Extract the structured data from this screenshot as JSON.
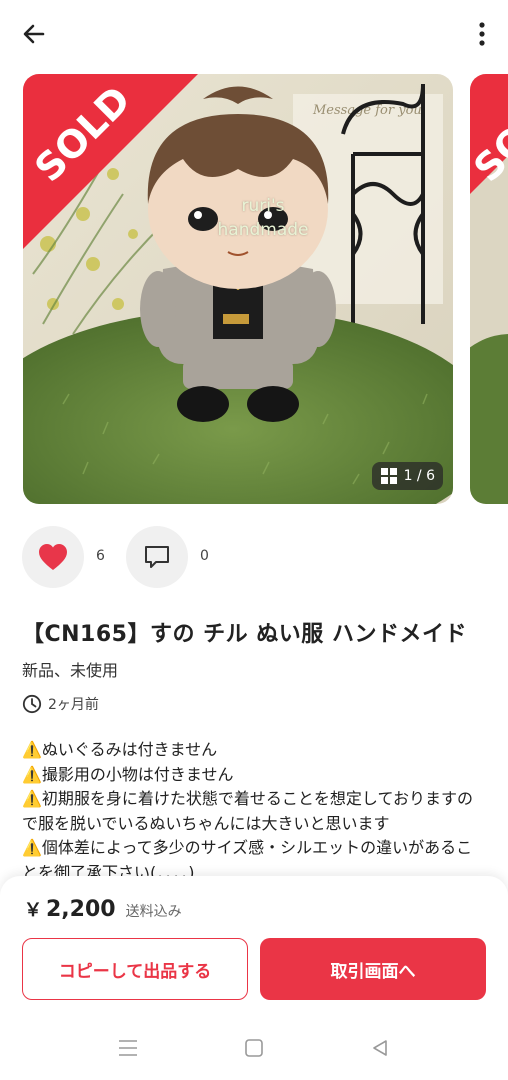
{
  "header": {
    "back_icon": "arrow-left-icon",
    "more_icon": "more-vertical-icon"
  },
  "gallery": {
    "sold_label": "SOLD",
    "watermark_line1": "ruri's",
    "watermark_line2": "handmade",
    "counter": "1 / 6",
    "counter_icon": "grid-icon"
  },
  "stats": {
    "likes": "6",
    "comments": "0"
  },
  "item": {
    "title": "【CN165】すの チル ぬい服 ハンドメイド",
    "condition": "新品、未使用",
    "posted": "2ヶ月前"
  },
  "description": "⚠️ぬいぐるみは付きません\n⚠️撮影用の小物は付きません\n⚠️初期服を身に着けた状態で着せることを想定しておりますので服を脱いでいるぬいちゃんには大きいと思います\n⚠️個体差によって多少のサイズ感・シルエットの違いがあることを御了承下さい(．．．．)",
  "purchase": {
    "currency": "￥",
    "price": "2,200",
    "shipping_note": "送料込み",
    "copy_button": "コピーして出品する",
    "trade_button": "取引画面へ"
  },
  "colors": {
    "accent": "#ea3546",
    "like_heart": "#e8364a",
    "grass": "#5d7d3a"
  }
}
